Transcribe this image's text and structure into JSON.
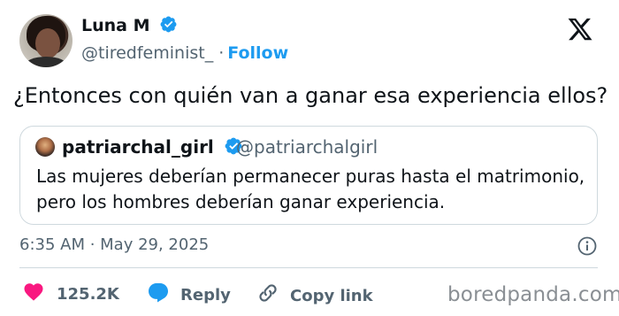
{
  "author": {
    "name": "Luna M",
    "handle": "@tiredfeminist_",
    "separator": "·",
    "follow_label": "Follow",
    "verified": true
  },
  "tweet": {
    "text": "¿Entonces con quién van a ganar esa experiencia ellos?",
    "timestamp": "6:35 AM · May 29, 2025"
  },
  "quoted_tweet": {
    "name": "patriarchal_girl",
    "handle": "@patriarchalgirl",
    "verified": true,
    "text_lines": [
      "Las mujeres deberían permanecer puras hasta el matrimonio,",
      "pero los hombres deberían ganar experiencia."
    ]
  },
  "actions": {
    "like_count": "125.2K",
    "reply_label": "Reply",
    "copy_link_label": "Copy link"
  },
  "watermark": "boredpanda.com",
  "colors": {
    "accent": "#1d9bf0",
    "like": "#f91880",
    "text": "#0f1419",
    "secondary": "#536471",
    "border": "#cfd9de"
  },
  "icons": [
    "x-logo-icon",
    "verified-badge-icon",
    "info-icon",
    "heart-icon",
    "reply-bubble-icon",
    "link-icon"
  ]
}
